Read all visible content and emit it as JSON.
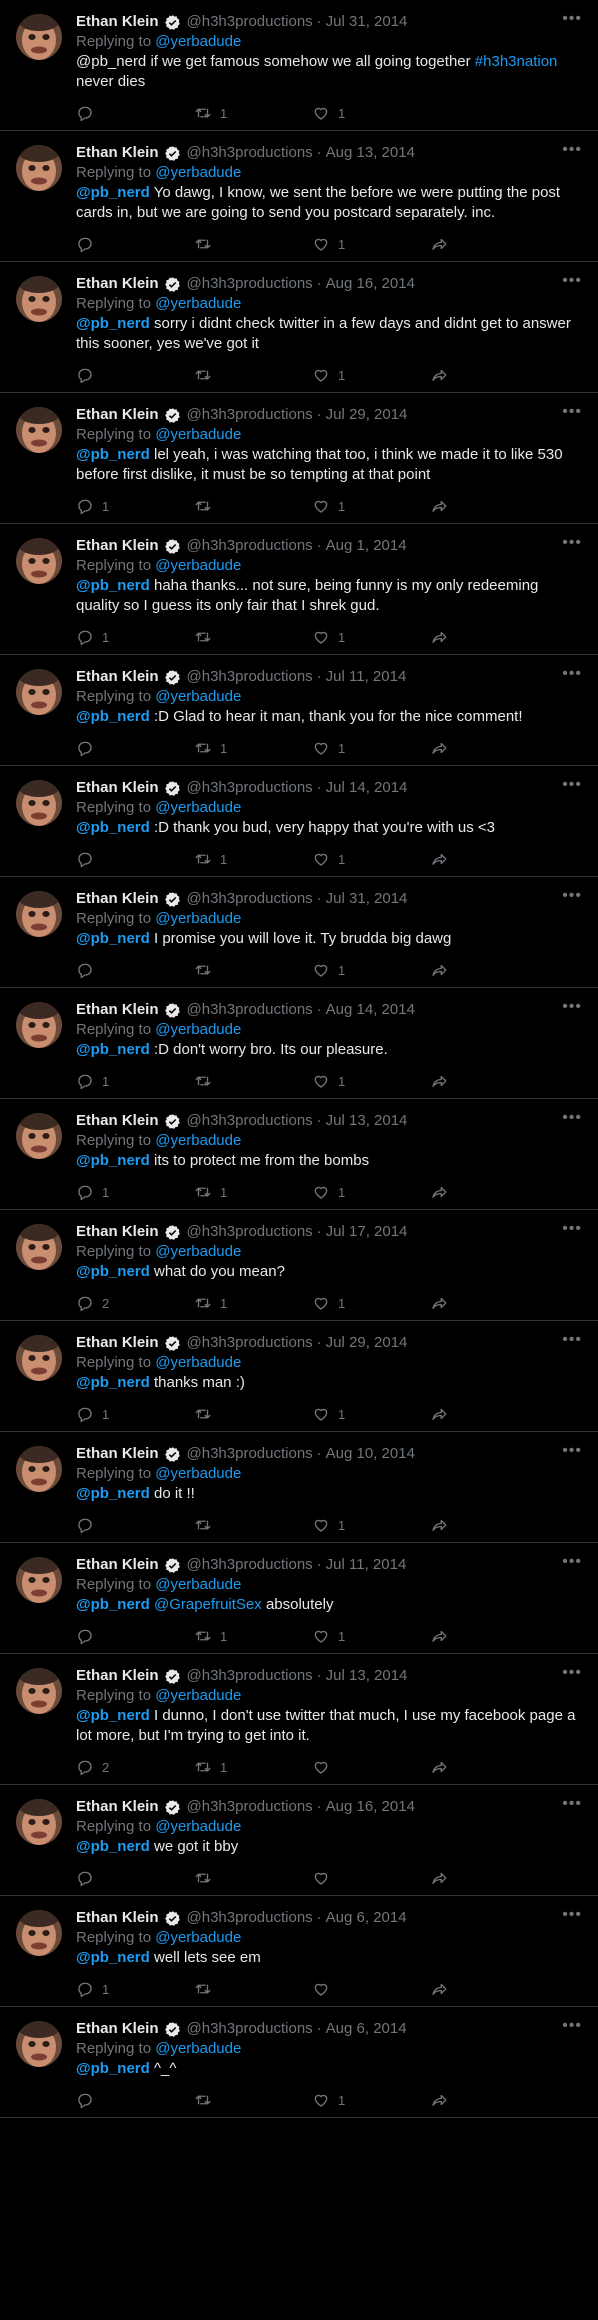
{
  "tweets": [
    {
      "name": "Ethan Klein",
      "handle": "@h3h3productions",
      "separator": "·",
      "date": "Jul 31, 2014",
      "replying_prefix": "Replying to",
      "replying_to": "@yerbadude",
      "mention": "",
      "mention2": "",
      "text": "@pb_nerd if we get famous somehow we all going together",
      "hashtag": "#h3h3nation",
      "text2": "never dies",
      "replies": "",
      "retweets": "1",
      "likes": "1",
      "share": false
    },
    {
      "name": "Ethan Klein",
      "handle": "@h3h3productions",
      "separator": "·",
      "date": "Aug 13, 2014",
      "replying_prefix": "Replying to",
      "replying_to": "@yerbadude",
      "mention": "@pb_nerd",
      "mention2": "",
      "text": "Yo dawg, I know, we sent the before we were putting the post cards in, but we are going to send you postcard separately. inc.",
      "hashtag": "",
      "text2": "",
      "replies": "",
      "retweets": "",
      "likes": "1",
      "share": true
    },
    {
      "name": "Ethan Klein",
      "handle": "@h3h3productions",
      "separator": "·",
      "date": "Aug 16, 2014",
      "replying_prefix": "Replying to",
      "replying_to": "@yerbadude",
      "mention": "@pb_nerd",
      "mention2": "",
      "text": "sorry i didnt check twitter in a few days and didnt get to answer this sooner, yes we've got it",
      "hashtag": "",
      "text2": "",
      "replies": "",
      "retweets": "",
      "likes": "1",
      "share": true
    },
    {
      "name": "Ethan Klein",
      "handle": "@h3h3productions",
      "separator": "·",
      "date": "Jul 29, 2014",
      "replying_prefix": "Replying to",
      "replying_to": "@yerbadude",
      "mention": "@pb_nerd",
      "mention2": "",
      "text": "lel yeah, i was watching that too, i think we made it to like 530 before first dislike, it must be so tempting at that point",
      "hashtag": "",
      "text2": "",
      "replies": "1",
      "retweets": "",
      "likes": "1",
      "share": true
    },
    {
      "name": "Ethan Klein",
      "handle": "@h3h3productions",
      "separator": "·",
      "date": "Aug 1, 2014",
      "replying_prefix": "Replying to",
      "replying_to": "@yerbadude",
      "mention": "@pb_nerd",
      "mention2": "",
      "text": "haha thanks... not sure, being funny is my only redeeming quality so I guess its only fair that I shrek gud.",
      "hashtag": "",
      "text2": "",
      "replies": "1",
      "retweets": "",
      "likes": "1",
      "share": true
    },
    {
      "name": "Ethan Klein",
      "handle": "@h3h3productions",
      "separator": "·",
      "date": "Jul 11, 2014",
      "replying_prefix": "Replying to",
      "replying_to": "@yerbadude",
      "mention": "@pb_nerd",
      "mention2": "",
      "text": ":D Glad to hear it man, thank you for the nice comment!",
      "hashtag": "",
      "text2": "",
      "replies": "",
      "retweets": "1",
      "likes": "1",
      "share": true
    },
    {
      "name": "Ethan Klein",
      "handle": "@h3h3productions",
      "separator": "·",
      "date": "Jul 14, 2014",
      "replying_prefix": "Replying to",
      "replying_to": "@yerbadude",
      "mention": "@pb_nerd",
      "mention2": "",
      "text": ":D thank you bud, very happy that you're with us <3",
      "hashtag": "",
      "text2": "",
      "replies": "",
      "retweets": "1",
      "likes": "1",
      "share": true
    },
    {
      "name": "Ethan Klein",
      "handle": "@h3h3productions",
      "separator": "·",
      "date": "Jul 31, 2014",
      "replying_prefix": "Replying to",
      "replying_to": "@yerbadude",
      "mention": "@pb_nerd",
      "mention2": "",
      "text": "I promise you will love it. Ty brudda big dawg",
      "hashtag": "",
      "text2": "",
      "replies": "",
      "retweets": "",
      "likes": "1",
      "share": true
    },
    {
      "name": "Ethan Klein",
      "handle": "@h3h3productions",
      "separator": "·",
      "date": "Aug 14, 2014",
      "replying_prefix": "Replying to",
      "replying_to": "@yerbadude",
      "mention": "@pb_nerd",
      "mention2": "",
      "text": ":D don't worry bro. Its our pleasure.",
      "hashtag": "",
      "text2": "",
      "replies": "1",
      "retweets": "",
      "likes": "1",
      "share": true
    },
    {
      "name": "Ethan Klein",
      "handle": "@h3h3productions",
      "separator": "·",
      "date": "Jul 13, 2014",
      "replying_prefix": "Replying to",
      "replying_to": "@yerbadude",
      "mention": "@pb_nerd",
      "mention2": "",
      "text": "its to protect me from the bombs",
      "hashtag": "",
      "text2": "",
      "replies": "1",
      "retweets": "1",
      "likes": "1",
      "share": true
    },
    {
      "name": "Ethan Klein",
      "handle": "@h3h3productions",
      "separator": "·",
      "date": "Jul 17, 2014",
      "replying_prefix": "Replying to",
      "replying_to": "@yerbadude",
      "mention": "@pb_nerd",
      "mention2": "",
      "text": "what do you mean?",
      "hashtag": "",
      "text2": "",
      "replies": "2",
      "retweets": "1",
      "likes": "1",
      "share": true
    },
    {
      "name": "Ethan Klein",
      "handle": "@h3h3productions",
      "separator": "·",
      "date": "Jul 29, 2014",
      "replying_prefix": "Replying to",
      "replying_to": "@yerbadude",
      "mention": "@pb_nerd",
      "mention2": "",
      "text": "thanks man :)",
      "hashtag": "",
      "text2": "",
      "replies": "1",
      "retweets": "",
      "likes": "1",
      "share": true
    },
    {
      "name": "Ethan Klein",
      "handle": "@h3h3productions",
      "separator": "·",
      "date": "Aug 10, 2014",
      "replying_prefix": "Replying to",
      "replying_to": "@yerbadude",
      "mention": "@pb_nerd",
      "mention2": "",
      "text": "do it !!",
      "hashtag": "",
      "text2": "",
      "replies": "",
      "retweets": "",
      "likes": "1",
      "share": true
    },
    {
      "name": "Ethan Klein",
      "handle": "@h3h3productions",
      "separator": "·",
      "date": "Jul 11, 2014",
      "replying_prefix": "Replying to",
      "replying_to": "@yerbadude",
      "mention": "@pb_nerd",
      "mention2": "@GrapefruitSex",
      "text": "absolutely",
      "hashtag": "",
      "text2": "",
      "replies": "",
      "retweets": "1",
      "likes": "1",
      "share": true
    },
    {
      "name": "Ethan Klein",
      "handle": "@h3h3productions",
      "separator": "·",
      "date": "Jul 13, 2014",
      "replying_prefix": "Replying to",
      "replying_to": "@yerbadude",
      "mention": "@pb_nerd",
      "mention2": "",
      "text": "I dunno, I don't use twitter that much, I use my facebook page a lot more, but I'm trying to get into it.",
      "hashtag": "",
      "text2": "",
      "replies": "2",
      "retweets": "1",
      "likes": "",
      "share": true
    },
    {
      "name": "Ethan Klein",
      "handle": "@h3h3productions",
      "separator": "·",
      "date": "Aug 16, 2014",
      "replying_prefix": "Replying to",
      "replying_to": "@yerbadude",
      "mention": "@pb_nerd",
      "mention2": "",
      "text": "we got it bby",
      "hashtag": "",
      "text2": "",
      "replies": "",
      "retweets": "",
      "likes": "",
      "share": true
    },
    {
      "name": "Ethan Klein",
      "handle": "@h3h3productions",
      "separator": "·",
      "date": "Aug 6, 2014",
      "replying_prefix": "Replying to",
      "replying_to": "@yerbadude",
      "mention": "@pb_nerd",
      "mention2": "",
      "text": "well lets see em",
      "hashtag": "",
      "text2": "",
      "replies": "1",
      "retweets": "",
      "likes": "",
      "share": true
    },
    {
      "name": "Ethan Klein",
      "handle": "@h3h3productions",
      "separator": "·",
      "date": "Aug 6, 2014",
      "replying_prefix": "Replying to",
      "replying_to": "@yerbadude",
      "mention": "@pb_nerd",
      "mention2": "",
      "text": "^_^",
      "hashtag": "",
      "text2": "",
      "replies": "",
      "retweets": "",
      "likes": "1",
      "share": true
    }
  ],
  "colors": {
    "background": "#000000",
    "text": "#e7e9ea",
    "muted": "#71767b",
    "link": "#1d9bf0",
    "divider": "#2f3336"
  },
  "icons": {
    "more": "more-icon",
    "verified": "verified-badge-icon",
    "reply": "reply-icon",
    "retweet": "retweet-icon",
    "like": "like-icon",
    "share": "share-icon"
  }
}
